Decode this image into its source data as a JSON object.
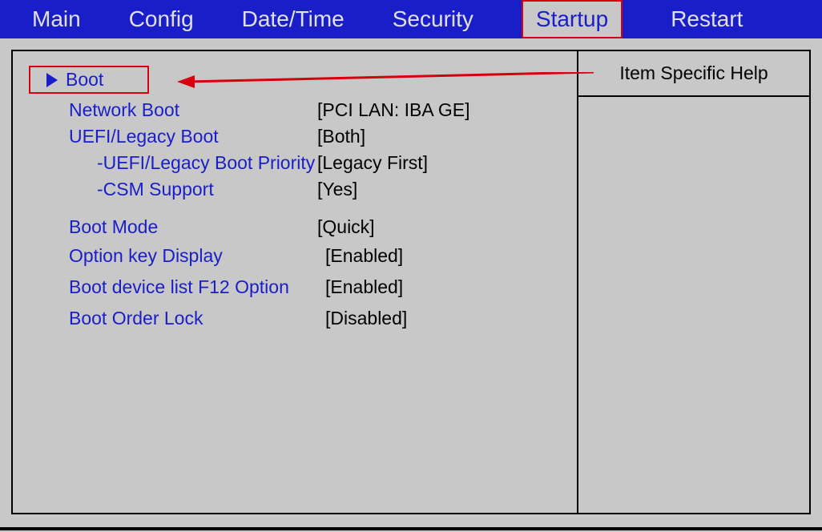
{
  "menubar": {
    "items": [
      {
        "label": "Main"
      },
      {
        "label": "Config"
      },
      {
        "label": "Date/Time"
      },
      {
        "label": "Security"
      },
      {
        "label": "Startup"
      },
      {
        "label": "Restart"
      }
    ],
    "activeIndex": 4
  },
  "help_panel": {
    "title": "Item Specific Help"
  },
  "settings": {
    "boot_submenu": {
      "label": "Boot"
    },
    "items": [
      {
        "label": "Network Boot",
        "value": "[PCI LAN: IBA GE]",
        "indent": 0
      },
      {
        "label": "UEFI/Legacy Boot",
        "value": "[Both]",
        "indent": 0
      },
      {
        "label": "-UEFI/Legacy Boot Priority",
        "value": "[Legacy First]",
        "indent": 1
      },
      {
        "label": "-CSM Support",
        "value": "[Yes]",
        "indent": 1
      }
    ],
    "items2": [
      {
        "label": "Boot Mode",
        "value": "[Quick]"
      },
      {
        "label": "Option key Display",
        "value": "[Enabled]"
      },
      {
        "label": "Boot device list F12 Option",
        "value": "[Enabled]"
      },
      {
        "label": "Boot Order Lock",
        "value": "[Disabled]"
      }
    ]
  },
  "annotation": {
    "arrow_color": "#d6000f"
  }
}
